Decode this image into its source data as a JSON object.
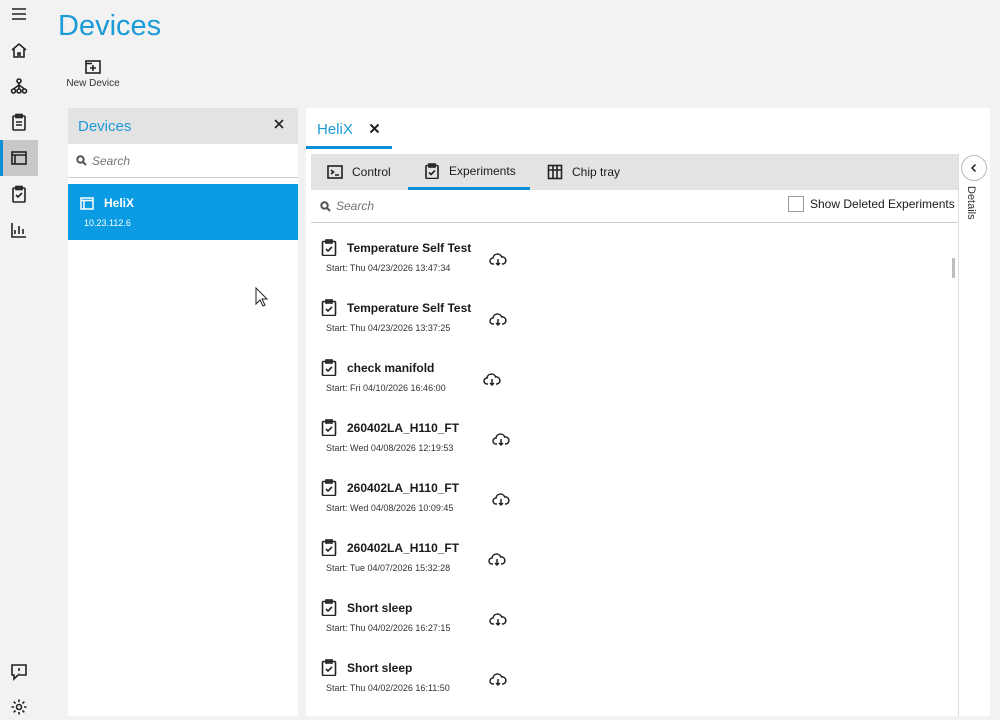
{
  "page_title": "Devices",
  "toolbar": {
    "new_device_label": "New Device"
  },
  "nav": {
    "items": [
      {
        "icon": "menu-icon"
      },
      {
        "icon": "home-icon"
      },
      {
        "icon": "hierarchy-icon"
      },
      {
        "icon": "clipboard-icon"
      },
      {
        "icon": "devices-icon",
        "active": true
      },
      {
        "icon": "checklist-icon"
      },
      {
        "icon": "chart-icon"
      }
    ],
    "bottom": [
      {
        "icon": "feedback-icon"
      },
      {
        "icon": "gear-icon"
      }
    ]
  },
  "devices_panel": {
    "title": "Devices",
    "search_placeholder": "Search",
    "items": [
      {
        "name": "HeliX",
        "ip": "10.23.112.6"
      }
    ]
  },
  "main": {
    "doc_tab_label": "HeliX",
    "tabs": [
      {
        "label": "Control",
        "icon": "terminal-icon"
      },
      {
        "label": "Experiments",
        "icon": "experiments-icon",
        "active": true
      },
      {
        "label": "Chip tray",
        "icon": "chip-tray-icon"
      }
    ],
    "search_placeholder": "Search",
    "show_deleted_label": "Show Deleted Experiments",
    "show_deleted_checked": false,
    "details_label": "Details",
    "experiments": [
      {
        "name": "Temperature Self Test",
        "start": "Start: Thu 04/23/2026 13:47:34"
      },
      {
        "name": "Temperature Self Test",
        "start": "Start: Thu 04/23/2026 13:37:25"
      },
      {
        "name": "check manifold",
        "start": "Start: Fri 04/10/2026 16:46:00"
      },
      {
        "name": "260402LA_H110_FT",
        "start": "Start: Wed 04/08/2026 12:19:53"
      },
      {
        "name": "260402LA_H110_FT",
        "start": "Start: Wed 04/08/2026 10:09:45"
      },
      {
        "name": "260402LA_H110_FT",
        "start": "Start: Tue 04/07/2026 15:32:28"
      },
      {
        "name": "Short sleep",
        "start": "Start: Thu 04/02/2026 16:27:15"
      },
      {
        "name": "Short sleep",
        "start": "Start: Thu 04/02/2026 16:11:50"
      }
    ]
  },
  "colors": {
    "accent": "#0a9be3",
    "title_blue": "#1a9ad6",
    "panel_header": "#e3e3e3",
    "background": "#f2f2f2"
  }
}
